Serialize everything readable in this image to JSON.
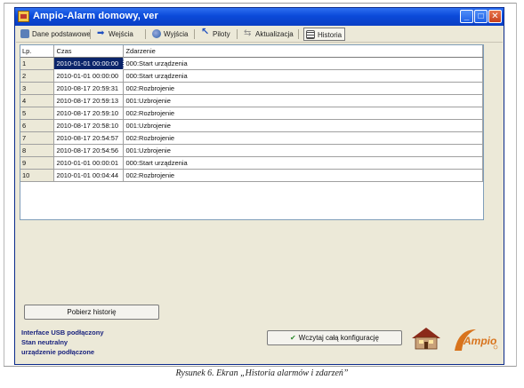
{
  "window": {
    "title": "Ampio-Alarm domowy, ver",
    "buttons": {
      "minimize": "_",
      "maximize": "□",
      "close": "✕"
    }
  },
  "toolbar": {
    "items": [
      {
        "label": "Dane podstawowe",
        "icon": "database-icon"
      },
      {
        "label": "Wejścia",
        "icon": "arrow-in-icon"
      },
      {
        "label": "Wyjścia",
        "icon": "globe-icon"
      },
      {
        "label": "Piloty",
        "icon": "cursor-icon"
      },
      {
        "label": "Aktualizacja",
        "icon": "update-icon"
      },
      {
        "label": "Historia",
        "icon": "grid-icon",
        "active": true
      }
    ]
  },
  "table": {
    "columns": [
      "Lp.",
      "Czas",
      "Zdarzenie"
    ],
    "rows": [
      {
        "lp": "1",
        "czas": "2010-01-01 00:00:00",
        "zdarzenie": "000:Start urządzenia",
        "selected": true
      },
      {
        "lp": "2",
        "czas": "2010-01-01 00:00:00",
        "zdarzenie": "000:Start urządzenia"
      },
      {
        "lp": "3",
        "czas": "2010-08-17 20:59:31",
        "zdarzenie": "002:Rozbrojenie"
      },
      {
        "lp": "4",
        "czas": "2010-08-17 20:59:13",
        "zdarzenie": "001:Uzbrojenie"
      },
      {
        "lp": "5",
        "czas": "2010-08-17 20:59:10",
        "zdarzenie": "002:Rozbrojenie"
      },
      {
        "lp": "6",
        "czas": "2010-08-17 20:58:10",
        "zdarzenie": "001:Uzbrojenie"
      },
      {
        "lp": "7",
        "czas": "2010-08-17 20:54:57",
        "zdarzenie": "002:Rozbrojenie"
      },
      {
        "lp": "8",
        "czas": "2010-08-17 20:54:56",
        "zdarzenie": "001:Uzbrojenie"
      },
      {
        "lp": "9",
        "czas": "2010-01-01 00:00:01",
        "zdarzenie": "000:Start urządzenia"
      },
      {
        "lp": "10",
        "czas": "2010-01-01 00:04:44",
        "zdarzenie": "002:Rozbrojenie"
      }
    ]
  },
  "actions": {
    "fetch_history": "Pobierz historię",
    "load_config": "Wczytaj całą konfigurację"
  },
  "status": {
    "line1": "Interface USB podłączony",
    "line2": "Stan neutralny",
    "line3": "urządzenie podłączone"
  },
  "brand": {
    "logo_text": "Ampio",
    "accent_color": "#d8731c"
  },
  "caption": "Rysunek 6. Ekran „Historia alarmów i zdarzeń”"
}
